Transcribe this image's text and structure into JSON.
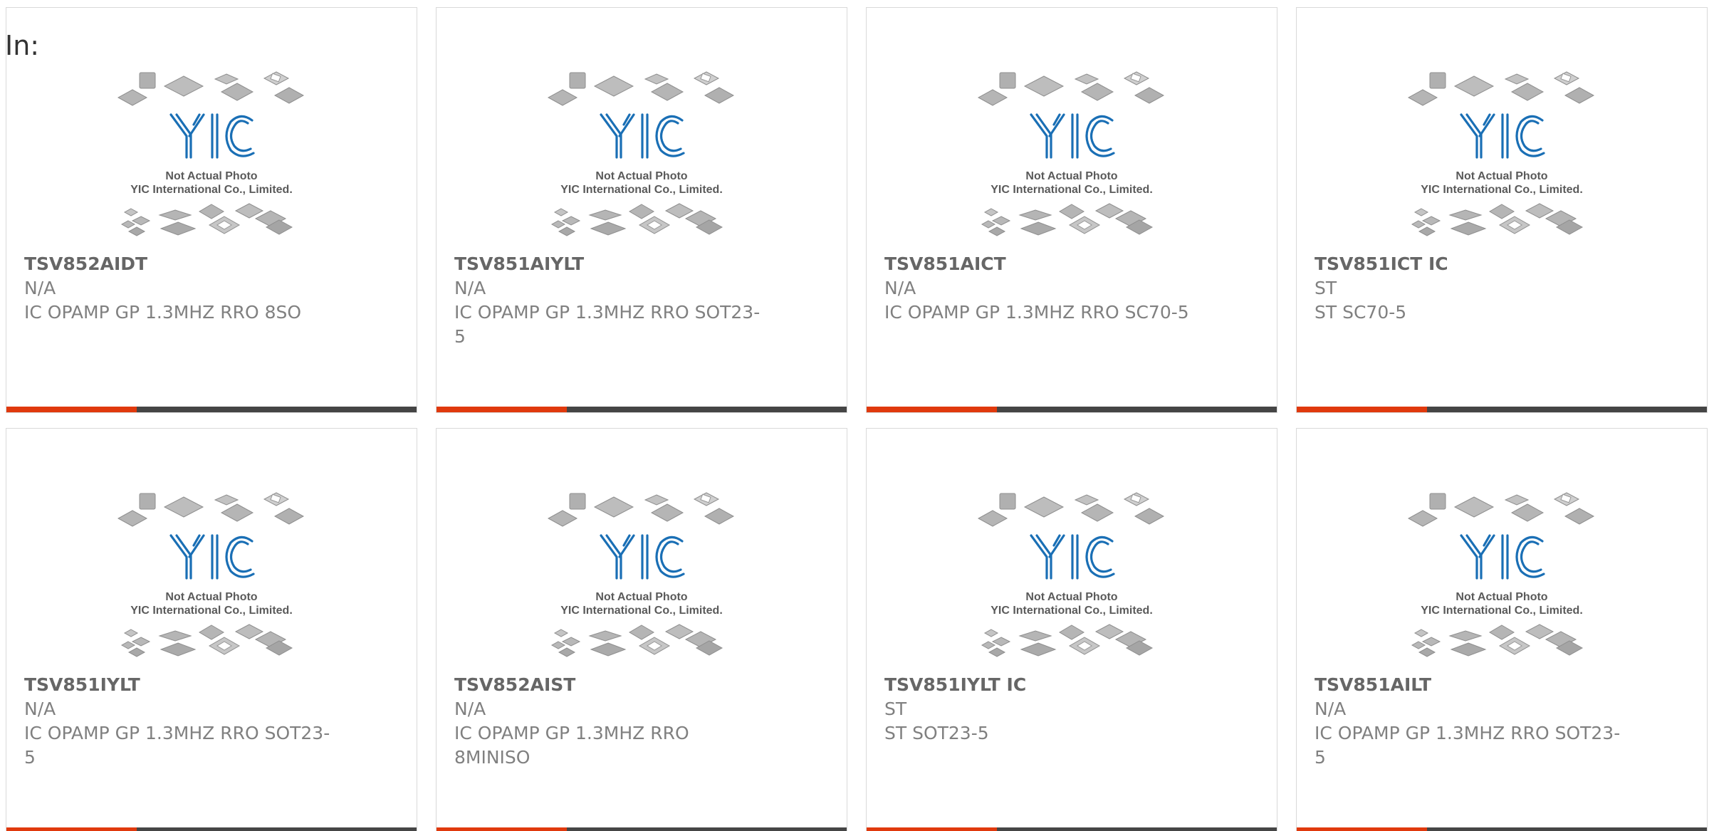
{
  "in_label": "In:",
  "placeholder": {
    "line1": "Not Actual Photo",
    "line2": "YIC International Co., Limited.",
    "logo": "YIC"
  },
  "colors": {
    "accent": "#e0390d",
    "bar": "#454545",
    "border": "#d9d9d9",
    "logo": "#1a6fb5",
    "text": "#666666"
  },
  "products": [
    {
      "part": "TSV852AIDT",
      "mfr": "N/A",
      "desc": "IC OPAMP GP 1.3MHZ RRO 8SO"
    },
    {
      "part": "TSV851AIYLT",
      "mfr": "N/A",
      "desc": "IC OPAMP GP 1.3MHZ RRO SOT23-5"
    },
    {
      "part": "TSV851AICT",
      "mfr": "N/A",
      "desc": "IC OPAMP GP 1.3MHZ RRO SC70-5"
    },
    {
      "part": "TSV851ICT IC",
      "mfr": "ST",
      "desc": "ST SC70-5"
    },
    {
      "part": "TSV851IYLT",
      "mfr": "N/A",
      "desc": "IC OPAMP GP 1.3MHZ RRO SOT23-5"
    },
    {
      "part": "TSV852AIST",
      "mfr": "N/A",
      "desc": "IC OPAMP GP 1.3MHZ RRO 8MINISO"
    },
    {
      "part": "TSV851IYLT IC",
      "mfr": "ST",
      "desc": "ST SOT23-5"
    },
    {
      "part": "TSV851AILT",
      "mfr": "N/A",
      "desc": "IC OPAMP GP 1.3MHZ RRO SOT23-5"
    }
  ]
}
